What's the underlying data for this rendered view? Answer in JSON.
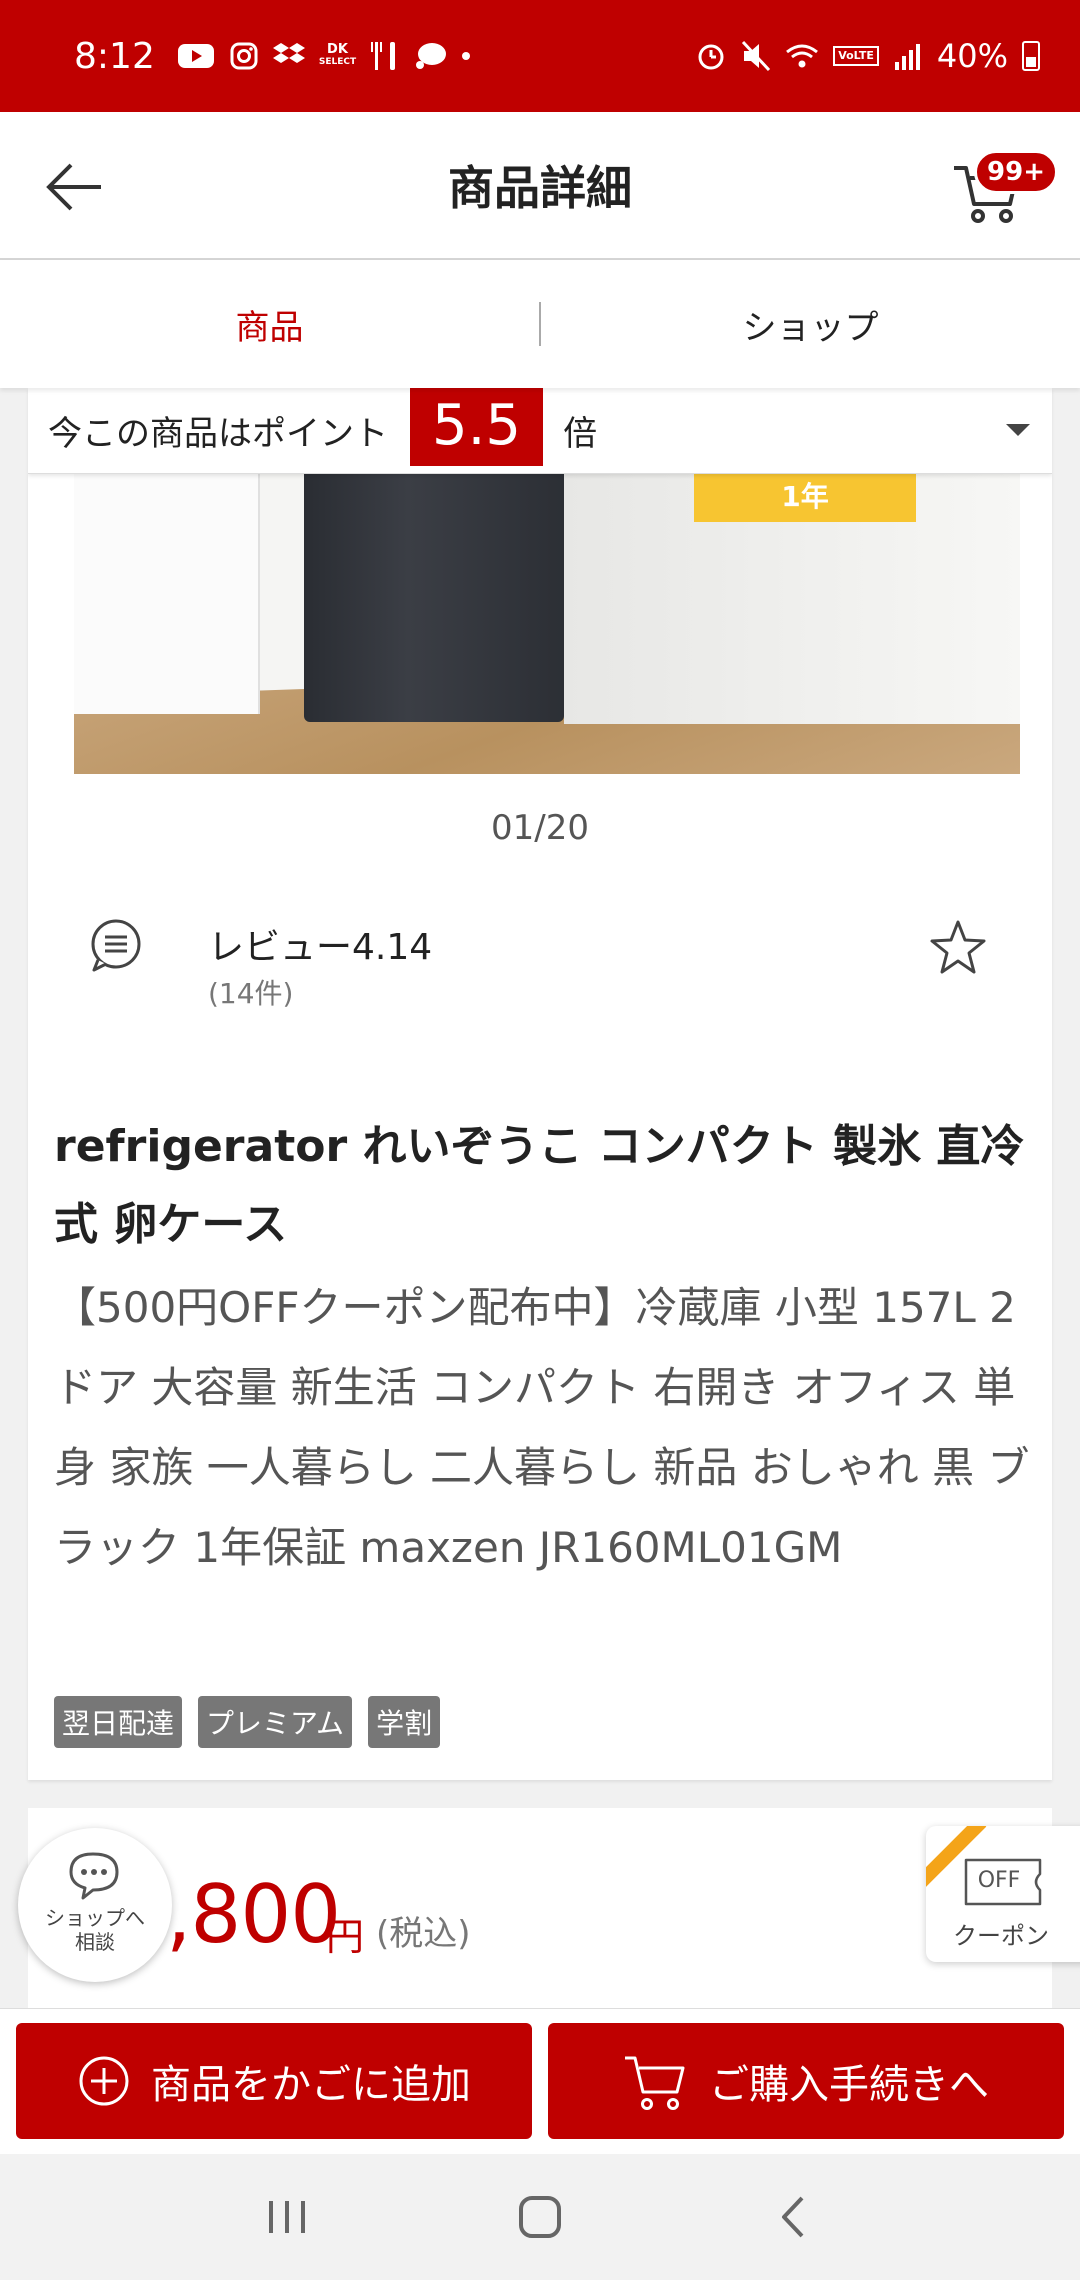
{
  "status_bar": {
    "time": "8:12",
    "battery": "40%",
    "dk_badge_line1": "DK",
    "dk_badge_line2": "SELECT",
    "volte_badge": "VoLTE"
  },
  "header": {
    "title": "商品詳細",
    "cart_badge": "99+"
  },
  "tabs": [
    {
      "label": "商品",
      "active": true
    },
    {
      "label": "ショップ",
      "active": false
    }
  ],
  "points": {
    "label": "今この商品はポイント",
    "value": "5.5",
    "suffix": "倍"
  },
  "image": {
    "badge": "1年",
    "counter": "01/20"
  },
  "review": {
    "label": "レビュー4.14",
    "count": "(14件)"
  },
  "product": {
    "title": "refrigerator れいぞうこ コンパクト 製氷 直冷式 卵ケース",
    "description": "【500円OFFクーポン配布中】冷蔵庫 小型 157L 2ドア 大容量 新生活 コンパクト 右開き オフィス 単身 家族 一人暮らし 二人暮らし 新品 おしゃれ 黒 ブラック 1年保証 maxzen JR160ML01GM",
    "tags": [
      "翌日配達",
      "プレミアム",
      "学割"
    ]
  },
  "price": {
    "value": ",800",
    "unit": "円",
    "tax": "(税込)"
  },
  "shop_consult": {
    "line1": "ショップへ",
    "line2": "相談"
  },
  "coupon": {
    "off": "OFF",
    "label": "クーポン"
  },
  "actions": {
    "add_to_cart": "商品をかごに追加",
    "checkout": "ご購入手続きへ"
  },
  "colors": {
    "brand": "#bf0000",
    "coupon_ribbon": "#f4a419"
  }
}
